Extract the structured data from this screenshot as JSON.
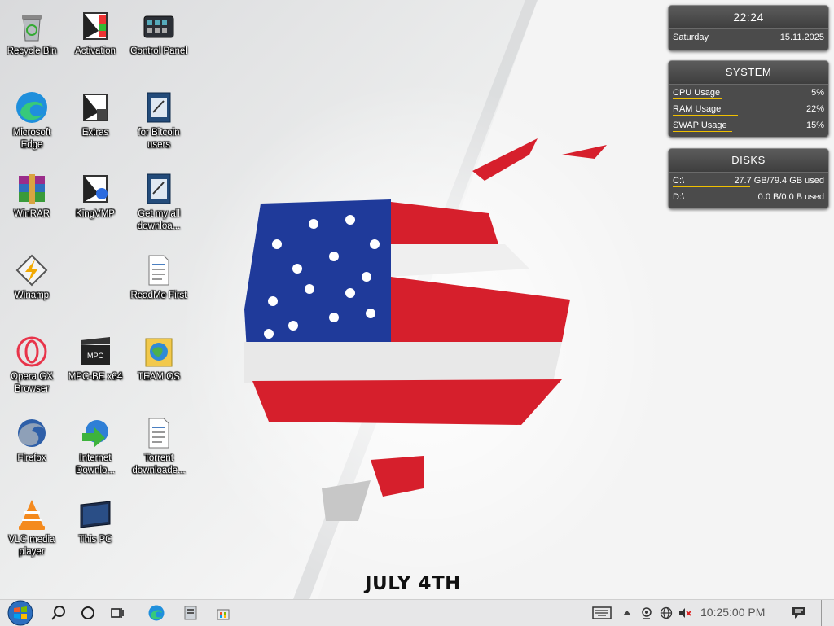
{
  "desktop_icons": [
    {
      "label": "Recycle Bin",
      "icon": "recycle-bin-icon"
    },
    {
      "label": "Activation",
      "icon": "activation-icon"
    },
    {
      "label": "Control Panel",
      "icon": "control-panel-icon"
    },
    {
      "label": "Microsoft Edge",
      "icon": "edge-icon"
    },
    {
      "label": "Extras",
      "icon": "extras-icon"
    },
    {
      "label": "for Bitcoin users",
      "icon": "notepad-icon"
    },
    {
      "label": "WinRAR",
      "icon": "winrar-icon"
    },
    {
      "label": "KingVMP",
      "icon": "kingvmp-icon"
    },
    {
      "label": "Get my all downloa...",
      "icon": "notepad-icon"
    },
    {
      "label": "Winamp",
      "icon": "winamp-icon"
    },
    {
      "label": "ReadMe First",
      "icon": "document-icon"
    },
    {
      "label": "Opera GX Browser",
      "icon": "opera-icon"
    },
    {
      "label": "MPC-BE x64",
      "icon": "mpc-be-icon"
    },
    {
      "label": "TEAM OS",
      "icon": "team-os-icon"
    },
    {
      "label": "Firefox",
      "icon": "firefox-icon"
    },
    {
      "label": "Internet Downlo...",
      "icon": "idm-icon"
    },
    {
      "label": "Torrent downloade...",
      "icon": "document-icon"
    },
    {
      "label": "VLC media player",
      "icon": "vlc-icon"
    },
    {
      "label": "This PC",
      "icon": "monitor-icon"
    }
  ],
  "clock_widget": {
    "time": "22:24",
    "day": "Saturday",
    "date": "15.11.2025"
  },
  "system_widget": {
    "title": "SYSTEM",
    "rows": [
      {
        "label": "CPU Usage",
        "value": "5%",
        "fill": 0.05
      },
      {
        "label": "RAM Usage",
        "value": "22%",
        "fill": 0.22
      },
      {
        "label": "SWAP Usage",
        "value": "15%",
        "fill": 0.15
      }
    ]
  },
  "disks_widget": {
    "title": "DISKS",
    "rows": [
      {
        "label": "C:\\",
        "value": "27.7 GB/79.4 GB used",
        "fill": 0.35
      },
      {
        "label": "D:\\",
        "value": "0.0 B/0.0 B used",
        "fill": 0.0
      }
    ]
  },
  "wallpaper": {
    "headline": "JULY 4TH",
    "colors": {
      "red": "#d61f2c",
      "blue": "#1f3a9a"
    }
  },
  "taskbar": {
    "clock": "10:25:00 PM",
    "icons": [
      "start-orb-icon",
      "search-icon",
      "cortana-circle-icon",
      "task-view-icon",
      "edge-icon",
      "file-explorer-icon",
      "store-icon",
      "keyboard-icon",
      "chevron-up-icon",
      "webcam-icon",
      "network-globe-icon",
      "volume-muted-icon",
      "notification-icon"
    ]
  }
}
